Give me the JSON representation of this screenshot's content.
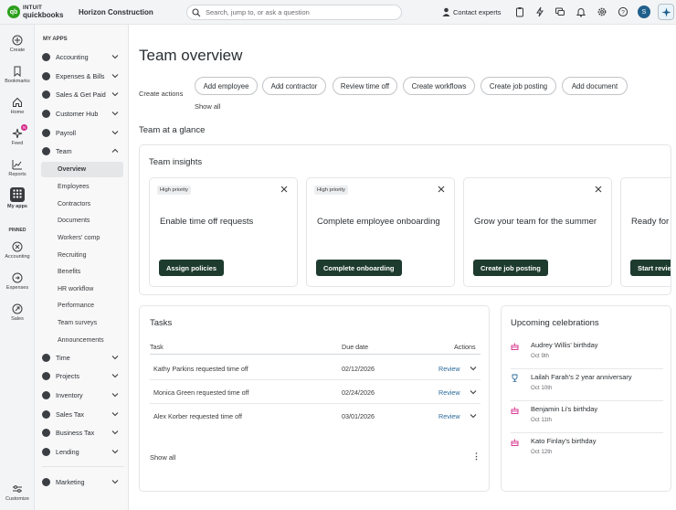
{
  "brand": {
    "intuit": "INTUIT",
    "product": "quickbooks",
    "company": "Horizon Construction"
  },
  "search": {
    "placeholder": "Search, jump to, or ask a question"
  },
  "topbar": {
    "contact_label": "Contact experts",
    "avatar_initial": "S"
  },
  "rail": {
    "items": [
      {
        "label": "Create",
        "icon": "plus-circle-icon"
      },
      {
        "label": "Bookmarks",
        "icon": "bookmark-icon"
      },
      {
        "label": "Home",
        "icon": "home-icon"
      },
      {
        "label": "Feed",
        "icon": "sparkle-icon",
        "badge": "N"
      },
      {
        "label": "Reports",
        "icon": "chart-icon"
      },
      {
        "label": "My apps",
        "icon": "grid-icon"
      }
    ],
    "pinned_label": "PINNED",
    "pinned": [
      {
        "label": "Accounting",
        "icon": "accounting-icon"
      },
      {
        "label": "Expenses",
        "icon": "expenses-icon"
      },
      {
        "label": "Sales",
        "icon": "sales-icon"
      }
    ],
    "customize_label": "Customize"
  },
  "nav": {
    "title": "MY APPS",
    "items": [
      {
        "label": "Accounting"
      },
      {
        "label": "Expenses & Bills"
      },
      {
        "label": "Sales & Get Paid"
      },
      {
        "label": "Customer Hub"
      },
      {
        "label": "Payroll"
      },
      {
        "label": "Team"
      }
    ],
    "team_sub": [
      "Overview",
      "Employees",
      "Contractors",
      "Documents",
      "Workers' comp",
      "Recruiting",
      "Benefits",
      "HR workflow",
      "Performance",
      "Team surveys",
      "Announcements"
    ],
    "items2": [
      {
        "label": "Time"
      },
      {
        "label": "Projects"
      },
      {
        "label": "Inventory"
      },
      {
        "label": "Sales Tax"
      },
      {
        "label": "Business Tax"
      },
      {
        "label": "Lending"
      }
    ],
    "marketing": "Marketing"
  },
  "main": {
    "title": "Team overview",
    "create_actions_label": "Create actions",
    "actions": [
      "Add employee",
      "Add contractor",
      "Review time off",
      "Create workflows",
      "Create job posting",
      "Add document"
    ],
    "show_all": "Show all",
    "glance_title": "Team at a glance",
    "insights": {
      "title": "Team insights",
      "cards": [
        {
          "priority": "High priority",
          "text": "Enable time off requests",
          "button": "Assign policies"
        },
        {
          "priority": "High priority",
          "text": "Complete employee onboarding",
          "button": "Complete onboarding"
        },
        {
          "priority": "",
          "text": "Grow your team for the summer",
          "button": "Create job posting"
        },
        {
          "priority": "",
          "text": "Ready for review?",
          "button": "Start review"
        }
      ]
    },
    "tasks": {
      "title": "Tasks",
      "headers": {
        "task": "Task",
        "due": "Due date",
        "actions": "Actions"
      },
      "rows": [
        {
          "task": "Kathy Parkins requested time off",
          "due": "02/12/2026",
          "action": "Review"
        },
        {
          "task": "Monica Green requested time off",
          "due": "02/24/2026",
          "action": "Review"
        },
        {
          "task": "Alex Korber requested time off",
          "due": "03/01/2026",
          "action": "Review"
        }
      ],
      "show_all": "Show all",
      "more": "⋮"
    },
    "celebrations": {
      "title": "Upcoming celebrations",
      "items": [
        {
          "name": "Audrey Willis' birthday",
          "date": "Oct 9th",
          "icon": "cake-icon"
        },
        {
          "name": "Lailah Farah's 2 year anniversary",
          "date": "Oct 10th",
          "icon": "trophy-icon"
        },
        {
          "name": "Benjamin Li's birthday",
          "date": "Oct 11th",
          "icon": "cake-icon"
        },
        {
          "name": "Kato Finlay's birthday",
          "date": "Oct 12th",
          "icon": "cake-icon"
        }
      ]
    }
  },
  "colors": {
    "brand_green": "#2ca01c",
    "button_dark": "#1d3b2f",
    "link_blue": "#2b6a99",
    "celebration_pink": "#d52b8a"
  }
}
